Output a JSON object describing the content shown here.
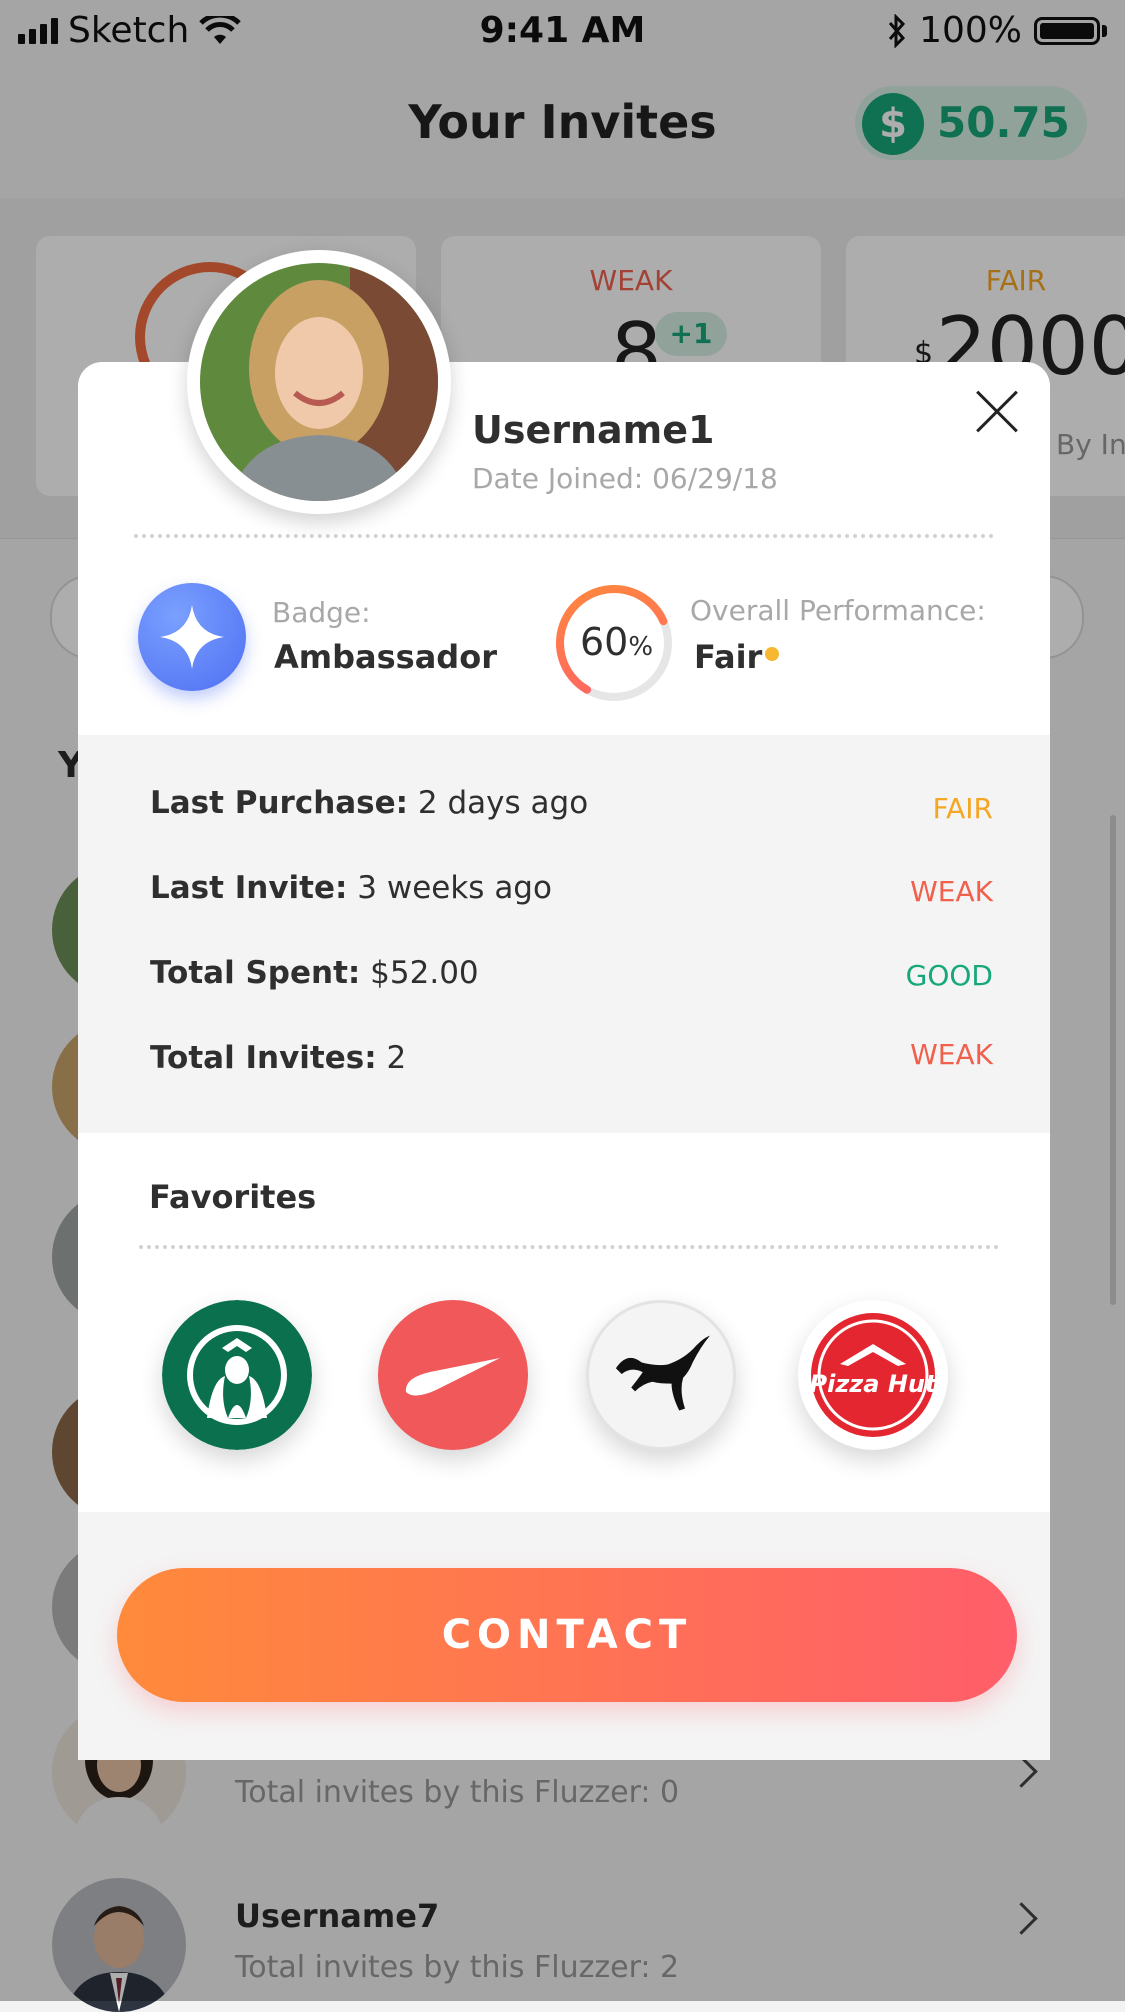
{
  "status_bar": {
    "carrier": "Sketch",
    "time": "9:41 AM",
    "battery": "100%"
  },
  "header": {
    "title": "Your Invites",
    "balance": "50.75",
    "currency_icon": "dollar-icon"
  },
  "stat_cards": [
    {
      "label": ""
    },
    {
      "label": "WEAK",
      "value": "8",
      "delta": "+1"
    },
    {
      "label": "FAIR",
      "value_prefix": "$",
      "value": "2000.",
      "subtitle": "By In"
    }
  ],
  "list": {
    "section_letter": "Y",
    "rows": [
      {
        "sub": "Total invites by this Fluzzer: 0"
      },
      {
        "name": "Username7",
        "sub": "Total invites by this Fluzzer: 2"
      }
    ]
  },
  "modal": {
    "username": "Username1",
    "date_joined": "Date Joined: 06/29/18",
    "badge_label": "Badge:",
    "badge_value": "Ambassador",
    "performance_label": "Overall Performance:",
    "performance_value": "Fair",
    "performance_percent": "60",
    "performance_percent_sign": "%",
    "performance_fraction": 0.6,
    "stats": [
      {
        "label": "Last Purchase:",
        "value": "2 days ago",
        "rating": "FAIR",
        "color": "#f5a623"
      },
      {
        "label": "Last Invite:",
        "value": "3 weeks ago",
        "rating": "WEAK",
        "color": "#f0604d"
      },
      {
        "label": "Total Spent:",
        "value": "$52.00",
        "rating": "GOOD",
        "color": "#17a77a"
      },
      {
        "label": "Total Invites:",
        "value": "2",
        "rating": "WEAK",
        "color": "#f0604d"
      }
    ],
    "favorites_title": "Favorites",
    "favorites": [
      {
        "icon": "starbucks-logo-icon"
      },
      {
        "icon": "nike-logo-icon"
      },
      {
        "icon": "puma-logo-icon"
      },
      {
        "icon": "pizza-hut-logo-icon",
        "logo_text": "Pizza Hut"
      }
    ],
    "contact_label": "CONTACT"
  },
  "colors": {
    "accent_green": "#17a77a",
    "fair": "#f5a623",
    "weak": "#f0604d",
    "contact_start": "#ff8a3b",
    "contact_end": "#ff5e6a"
  }
}
